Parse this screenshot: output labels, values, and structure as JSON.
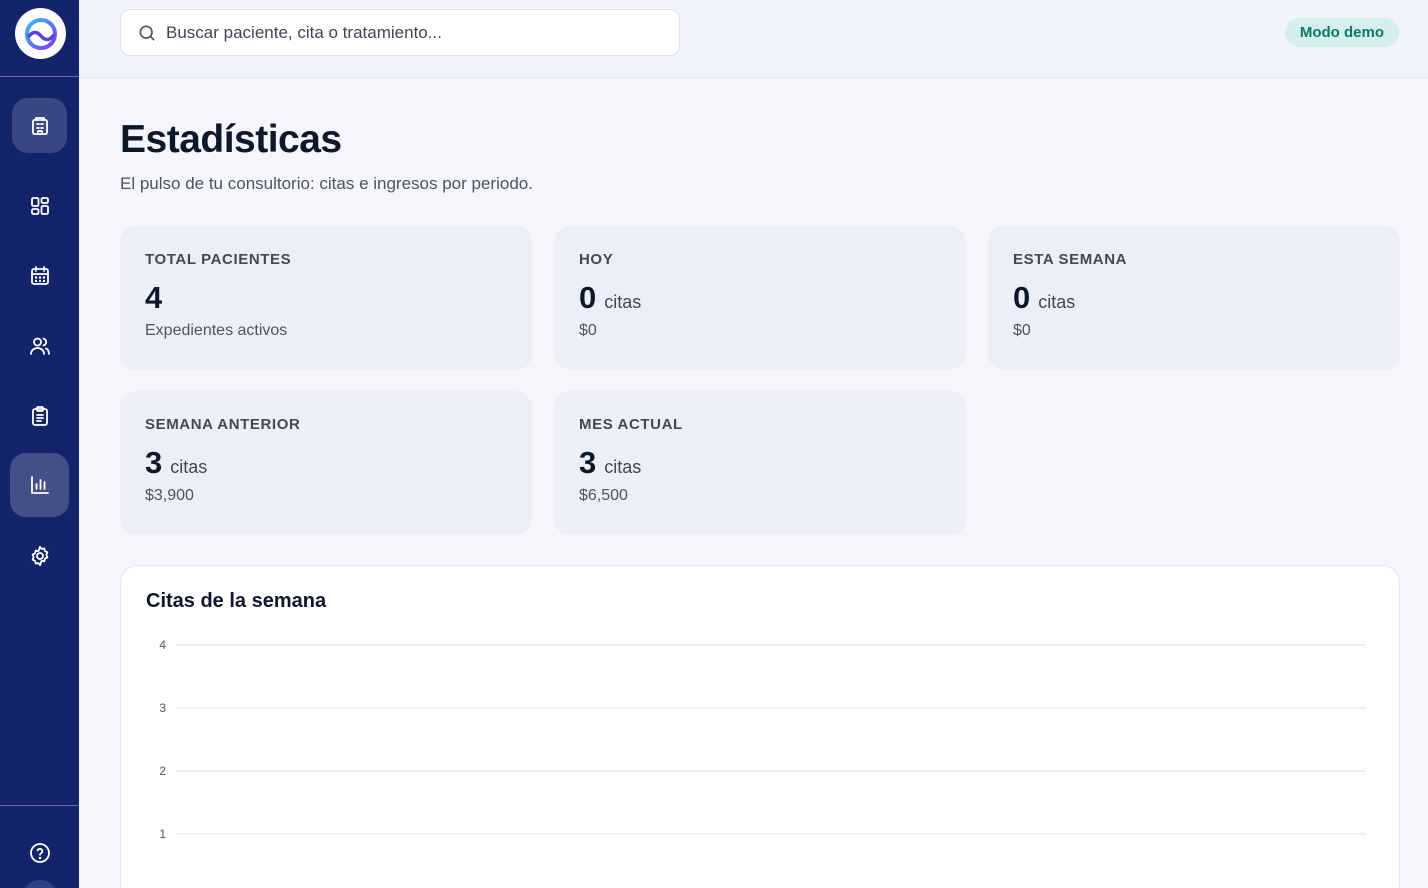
{
  "sidebar": {
    "logo": "app-logo",
    "items": [
      {
        "name": "clinic-icon",
        "active": false
      },
      {
        "name": "dashboard-icon",
        "active": false
      },
      {
        "name": "calendar-icon",
        "active": false
      },
      {
        "name": "users-icon",
        "active": false
      },
      {
        "name": "clipboard-icon",
        "active": false
      },
      {
        "name": "bar-chart-icon",
        "active": true
      },
      {
        "name": "gear-icon",
        "active": false
      }
    ],
    "help": "help-circle-icon"
  },
  "topbar": {
    "search_placeholder": "Buscar paciente, cita o tratamiento...",
    "search_value": "",
    "demo_badge": "Modo demo"
  },
  "page": {
    "title": "Estadísticas",
    "subtitle": "El pulso de tu consultorio: citas e ingresos por periodo."
  },
  "stats": {
    "total": {
      "label": "TOTAL PACIENTES",
      "value": "4",
      "unit": "",
      "sub": "Expedientes activos"
    },
    "today": {
      "label": "HOY",
      "value": "0",
      "unit": "citas",
      "sub": "$0"
    },
    "week": {
      "label": "ESTA SEMANA",
      "value": "0",
      "unit": "citas",
      "sub": "$0"
    },
    "prev_week": {
      "label": "SEMANA ANTERIOR",
      "value": "3",
      "unit": "citas",
      "sub": "$3,900"
    },
    "month": {
      "label": "MES ACTUAL",
      "value": "3",
      "unit": "citas",
      "sub": "$6,500"
    }
  },
  "colors": {
    "sidebar": "#14246b",
    "accent_badge": "#0f766e",
    "card_bg": "#ecf0f6"
  },
  "chart_data": {
    "type": "bar",
    "title": "Citas de la semana",
    "xlabel": "",
    "ylabel": "",
    "y_ticks": [
      4,
      3,
      2,
      1
    ],
    "ylim": [
      0,
      4
    ],
    "grid": true,
    "categories": [],
    "series": []
  }
}
